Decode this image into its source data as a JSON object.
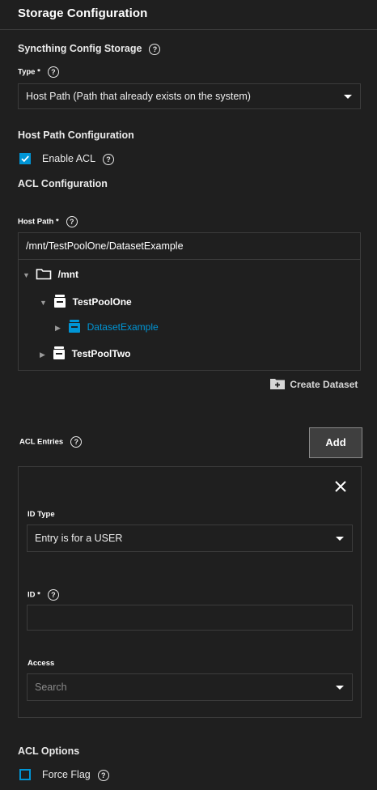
{
  "section_title": "Storage Configuration",
  "config_storage": {
    "label": "Syncthing Config Storage"
  },
  "type_field": {
    "label": "Type",
    "required_mark": "*",
    "value": "Host Path (Path that already exists on the system)"
  },
  "host_path_config": {
    "label": "Host Path Configuration"
  },
  "enable_acl": {
    "label": "Enable ACL",
    "checked": true
  },
  "acl_config": {
    "label": "ACL Configuration"
  },
  "host_path": {
    "label": "Host Path",
    "required_mark": "*",
    "value": "/mnt/TestPoolOne/DatasetExample"
  },
  "tree": {
    "root": "/mnt",
    "pool1": "TestPoolOne",
    "dataset": "DatasetExample",
    "pool2": "TestPoolTwo"
  },
  "create_dataset_label": "Create Dataset",
  "acl_entries": {
    "label": "ACL Entries",
    "add_label": "Add"
  },
  "entry": {
    "id_type_label": "ID Type",
    "id_type_value": "Entry is for a USER",
    "id_label": "ID",
    "id_required_mark": "*",
    "id_value": "",
    "access_label": "Access",
    "access_placeholder": "Search"
  },
  "acl_options": {
    "label": "ACL Options"
  },
  "force_flag": {
    "label": "Force Flag",
    "checked": false
  },
  "colors": {
    "accent": "#0095d5",
    "background": "#1f1f1f",
    "border": "#3c3c3c"
  },
  "icons": [
    "help-icon",
    "folder-icon",
    "pool-icon",
    "dataset-icon",
    "create-folder-icon",
    "close-icon",
    "check-icon"
  ]
}
